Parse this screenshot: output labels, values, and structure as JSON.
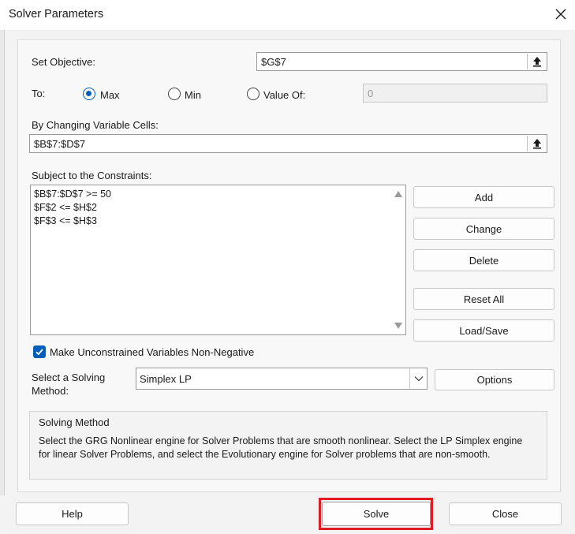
{
  "window": {
    "title": "Solver Parameters"
  },
  "objective": {
    "label": "Set Objective:",
    "value": "$G$7"
  },
  "to": {
    "label": "To:",
    "options": [
      {
        "label": "Max",
        "checked": true
      },
      {
        "label": "Min",
        "checked": false
      },
      {
        "label": "Value Of:",
        "checked": false
      }
    ],
    "value_of": "0"
  },
  "changing_cells": {
    "label": "By Changing Variable Cells:",
    "value": "$B$7:$D$7"
  },
  "constraints": {
    "label": "Subject to the Constraints:",
    "items": [
      "$B$7:$D$7 >= 50",
      "$F$2 <= $H$2",
      "$F$3 <= $H$3"
    ]
  },
  "constraint_buttons": {
    "add": "Add",
    "change": "Change",
    "delete": "Delete",
    "reset_all": "Reset All",
    "load_save": "Load/Save"
  },
  "non_negative": {
    "label": "Make Unconstrained Variables Non-Negative",
    "checked": true
  },
  "solving_method": {
    "label_line1": "Select a Solving",
    "label_line2": "Method:",
    "selected": "Simplex LP",
    "options_button": "Options"
  },
  "method_info": {
    "title": "Solving Method",
    "description": "Select the GRG Nonlinear engine for Solver Problems that are smooth nonlinear. Select the LP Simplex engine for linear Solver Problems, and select the Evolutionary engine for Solver problems that are non-smooth."
  },
  "footer": {
    "help": "Help",
    "solve": "Solve",
    "close": "Close"
  },
  "colors": {
    "accent": "#005fb8",
    "highlight": "#e01b24"
  }
}
